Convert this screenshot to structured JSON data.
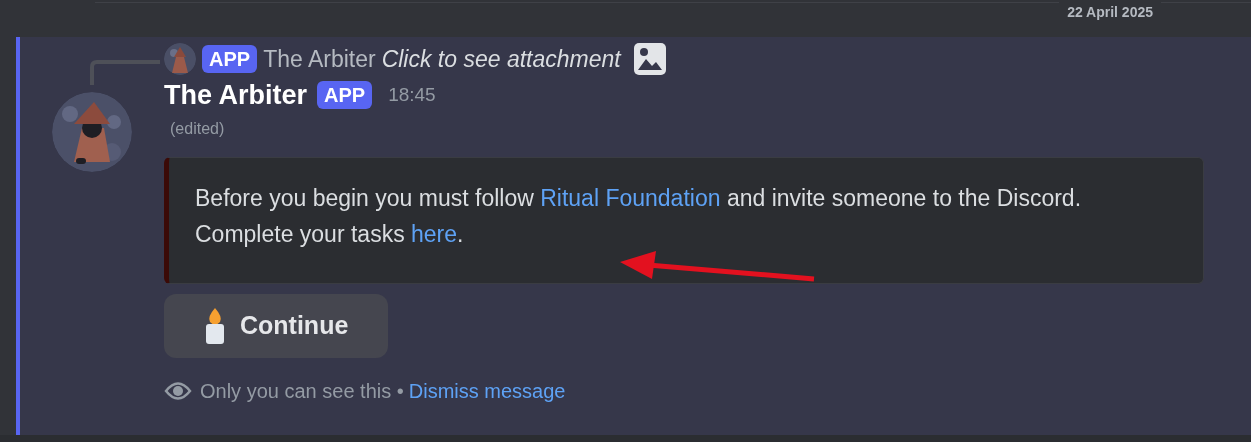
{
  "date_divider": "22 April 2025",
  "reply": {
    "badge": "APP",
    "author": "The Arbiter",
    "text": "Click to see attachment"
  },
  "message": {
    "author": "The Arbiter",
    "badge": "APP",
    "time": "18:45",
    "edited": "(edited)",
    "embed": [
      {
        "text": "Before you begin you must follow ",
        "link": false
      },
      {
        "text": "Ritual Foundation",
        "link": true
      },
      {
        "text": " and invite someone to the Discord. Complete your tasks ",
        "link": false
      },
      {
        "text": "here",
        "link": true
      },
      {
        "text": ".",
        "link": false
      }
    ],
    "buttons": [
      {
        "label": "Continue"
      }
    ],
    "notice": "Only you can see this •",
    "dismiss": "Dismiss message"
  }
}
